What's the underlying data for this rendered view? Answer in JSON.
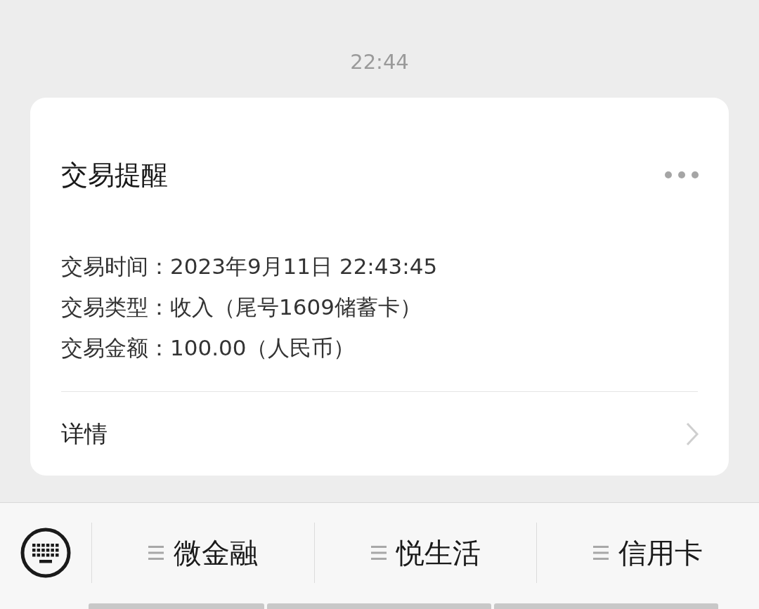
{
  "timestamp": "22:44",
  "card": {
    "title": "交易提醒",
    "lines": [
      "交易时间：2023年9月11日 22:43:45",
      "交易类型：收入（尾号1609储蓄卡）",
      "交易金额：100.00（人民币）"
    ],
    "link": "详情"
  },
  "menu": [
    {
      "label": "微金融"
    },
    {
      "label": "悦生活"
    },
    {
      "label": "信用卡"
    }
  ]
}
